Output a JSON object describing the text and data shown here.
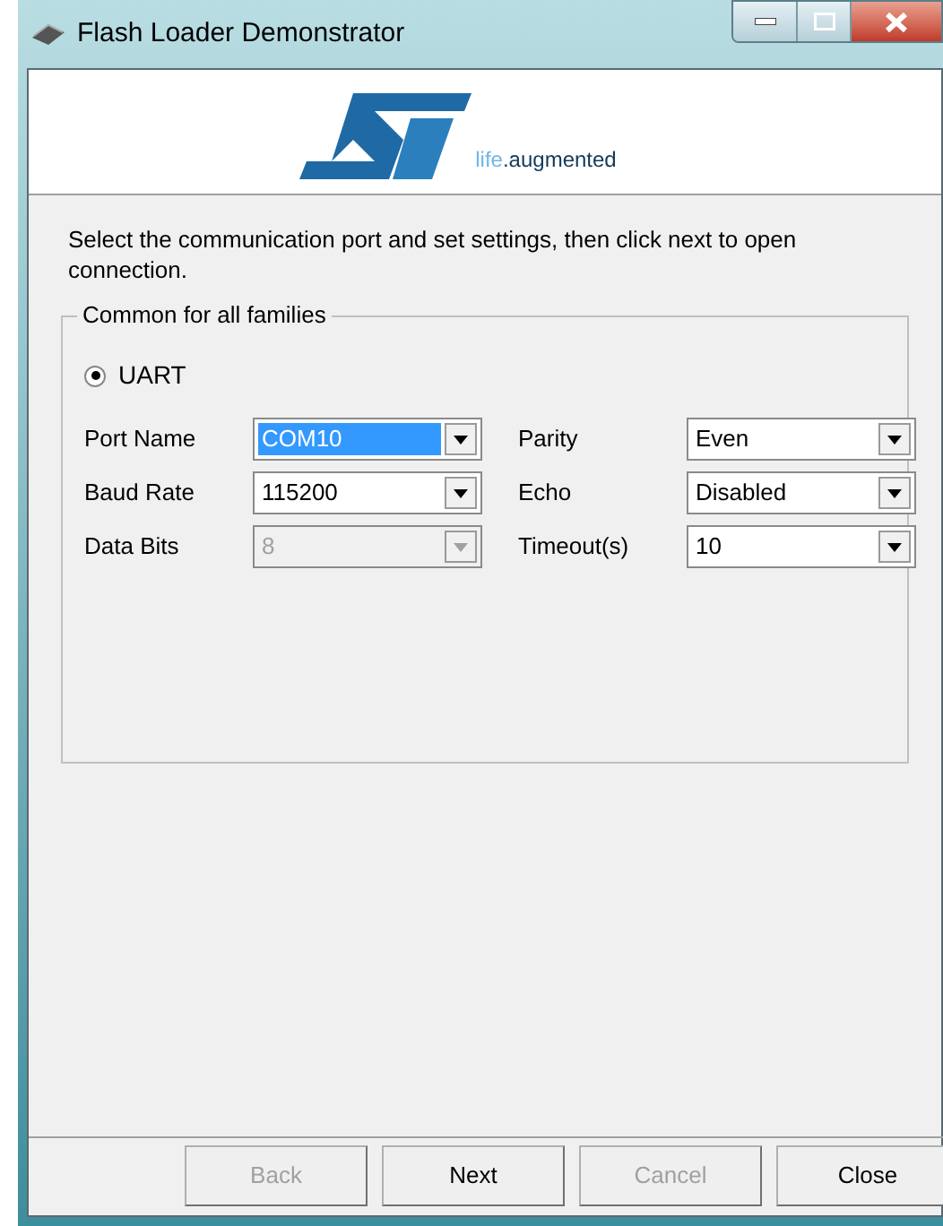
{
  "window": {
    "title": "Flash Loader Demonstrator"
  },
  "logo": {
    "tagline_start": "life",
    "tagline_end": ".augmented"
  },
  "instructions": "Select the communication port and set settings, then click next to open connection.",
  "group": {
    "title": "Common for all families",
    "radio": {
      "label": "UART",
      "selected": true
    },
    "fields": [
      {
        "label": "Port Name",
        "value": "COM10",
        "disabled": false,
        "highlighted": true
      },
      {
        "label": "Parity",
        "value": "Even",
        "disabled": false,
        "highlighted": false
      },
      {
        "label": "Baud Rate",
        "value": "115200",
        "disabled": false,
        "highlighted": false
      },
      {
        "label": "Echo",
        "value": "Disabled",
        "disabled": false,
        "highlighted": false
      },
      {
        "label": "Data Bits",
        "value": "8",
        "disabled": true,
        "highlighted": false
      },
      {
        "label": "Timeout(s)",
        "value": "10",
        "disabled": false,
        "highlighted": false
      }
    ]
  },
  "buttons": [
    {
      "label": "Back",
      "disabled": true
    },
    {
      "label": "Next",
      "disabled": false
    },
    {
      "label": "Cancel",
      "disabled": true
    },
    {
      "label": "Close",
      "disabled": false
    }
  ]
}
